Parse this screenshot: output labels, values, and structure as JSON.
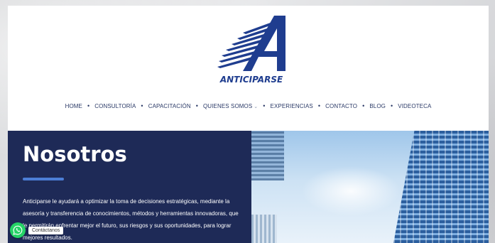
{
  "logo": {
    "text": "ANTICIPARSE",
    "colors": {
      "brand": "#1f3d8f"
    }
  },
  "nav": {
    "items": [
      {
        "label": "HOME"
      },
      {
        "label": "CONSULTORÍA"
      },
      {
        "label": "CAPACITACIÓN"
      },
      {
        "label": "QUIENES SOMOS"
      },
      {
        "label": "EXPERIENCIAS"
      },
      {
        "label": "CONTACTO"
      },
      {
        "label": "BLOG"
      },
      {
        "label": "VIDEOTECA"
      }
    ],
    "submenu_indicator_icon": "chevron-down-icon"
  },
  "hero": {
    "title": "Nosotros",
    "paragraph": "Anticiparse le ayudará a optimizar la toma de decisiones estratégicas, mediante la asesoría y transferencia de conocimientos, métodos y herramientas innovadoras, que le permitirán enfrentar mejor el futuro, sus riesgos y sus oportunidades, para lograr mejores resultados.",
    "colors": {
      "panel": "#1e2a57",
      "accent": "#4d7fd6"
    }
  },
  "whatsapp": {
    "label": "Contáctanos",
    "icon": "whatsapp-icon"
  }
}
